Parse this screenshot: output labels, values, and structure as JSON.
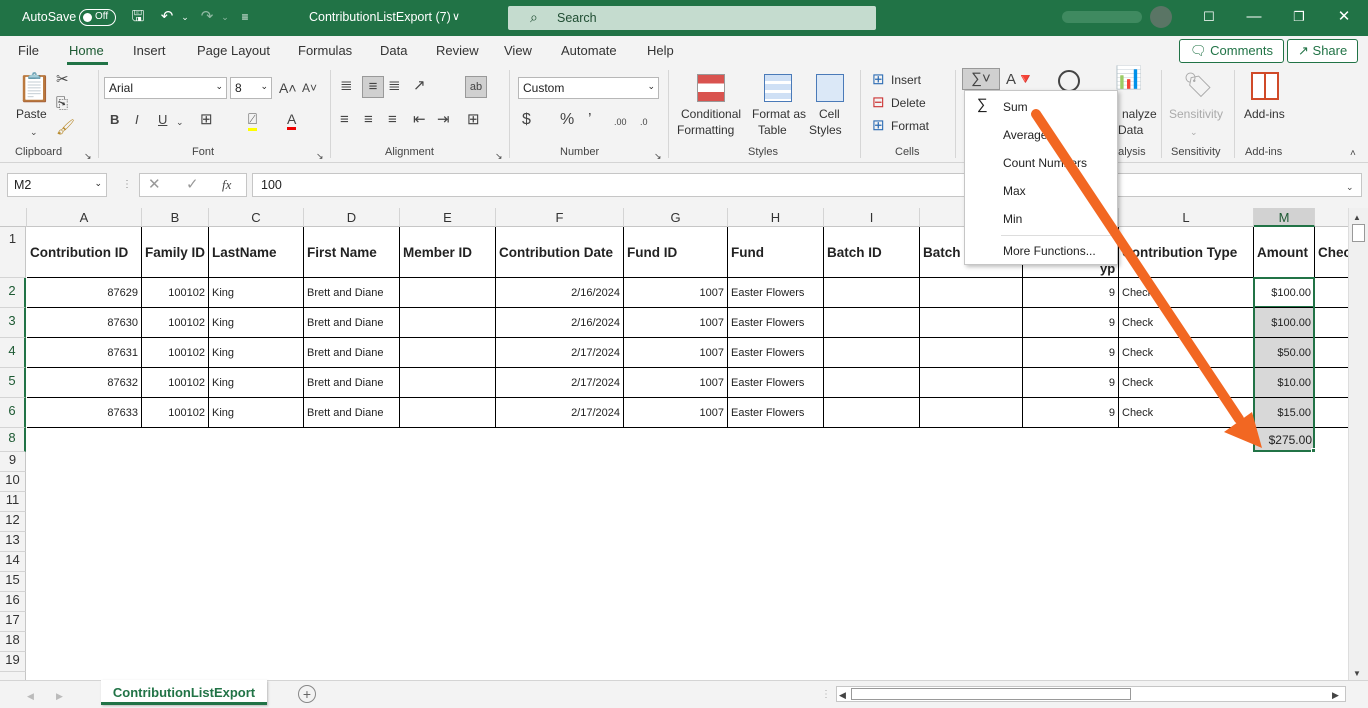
{
  "titlebar": {
    "autosave": "AutoSave",
    "toggle": "Off",
    "filename": "ContributionListExport (7)",
    "search": "Search",
    "bg": "#217346"
  },
  "menu": {
    "tabs": [
      "File",
      "Home",
      "Insert",
      "Page Layout",
      "Formulas",
      "Data",
      "Review",
      "View",
      "Automate",
      "Help"
    ],
    "comments": "Comments",
    "share": "Share"
  },
  "ribbon": {
    "paste": "Paste",
    "font_name": "Arial",
    "font_size": "8",
    "number_format": "Custom",
    "conditional": [
      "Conditional",
      "Formatting"
    ],
    "format_table": [
      "Format as",
      "Table"
    ],
    "cell_styles": [
      "Cell",
      "Styles"
    ],
    "insert": "Insert",
    "delete": "Delete",
    "format": "Format",
    "analyze": [
      "nalyze",
      "Data"
    ],
    "sensitivity": "Sensitivity",
    "addins": "Add-ins",
    "groups": [
      "Clipboard",
      "Font",
      "Alignment",
      "Number",
      "Styles",
      "Cells",
      "nalysis",
      "Sensitivity",
      "Add-ins"
    ]
  },
  "formula_bar": {
    "name_box": "M2",
    "fx": "fx",
    "value": "100"
  },
  "grid": {
    "columns": [
      "A",
      "B",
      "C",
      "D",
      "E",
      "F",
      "G",
      "H",
      "I",
      "",
      "",
      "L",
      "M"
    ],
    "rows": [
      "1",
      "2",
      "3",
      "4",
      "5",
      "6",
      "8",
      "9",
      "10",
      "11",
      "12",
      "13",
      "14",
      "15",
      "16",
      "17",
      "18",
      "19"
    ],
    "headers": [
      "Contribution ID",
      "Family ID",
      "LastName",
      "First Name",
      "Member ID",
      "Contribution Date",
      "Fund ID",
      "Fund",
      "Batch ID",
      "Batch",
      "",
      "Contribution Type",
      "Amount",
      "Chec"
    ],
    "header_fragment": "yp",
    "data": [
      [
        "87629",
        "100102",
        "King",
        "Brett and Diane",
        "",
        "2/16/2024",
        "1007",
        "Easter Flowers",
        "",
        "",
        "9",
        "Check",
        "$100.00"
      ],
      [
        "87630",
        "100102",
        "King",
        "Brett and Diane",
        "",
        "2/16/2024",
        "1007",
        "Easter Flowers",
        "",
        "",
        "9",
        "Check",
        "$100.00"
      ],
      [
        "87631",
        "100102",
        "King",
        "Brett and Diane",
        "",
        "2/17/2024",
        "1007",
        "Easter Flowers",
        "",
        "",
        "9",
        "Check",
        "$50.00"
      ],
      [
        "87632",
        "100102",
        "King",
        "Brett and Diane",
        "",
        "2/17/2024",
        "1007",
        "Easter Flowers",
        "",
        "",
        "9",
        "Check",
        "$10.00"
      ],
      [
        "87633",
        "100102",
        "King",
        "Brett and Diane",
        "",
        "2/17/2024",
        "1007",
        "Easter Flowers",
        "",
        "",
        "9",
        "Check",
        "$15.00"
      ]
    ],
    "total": "$275.00"
  },
  "autosum_menu": {
    "items": [
      "Sum",
      "Average",
      "Count Numbers",
      "Max",
      "Min",
      "More Functions..."
    ]
  },
  "sheet": {
    "tab": "ContributionListExport"
  },
  "annotation_color": "#F26722"
}
